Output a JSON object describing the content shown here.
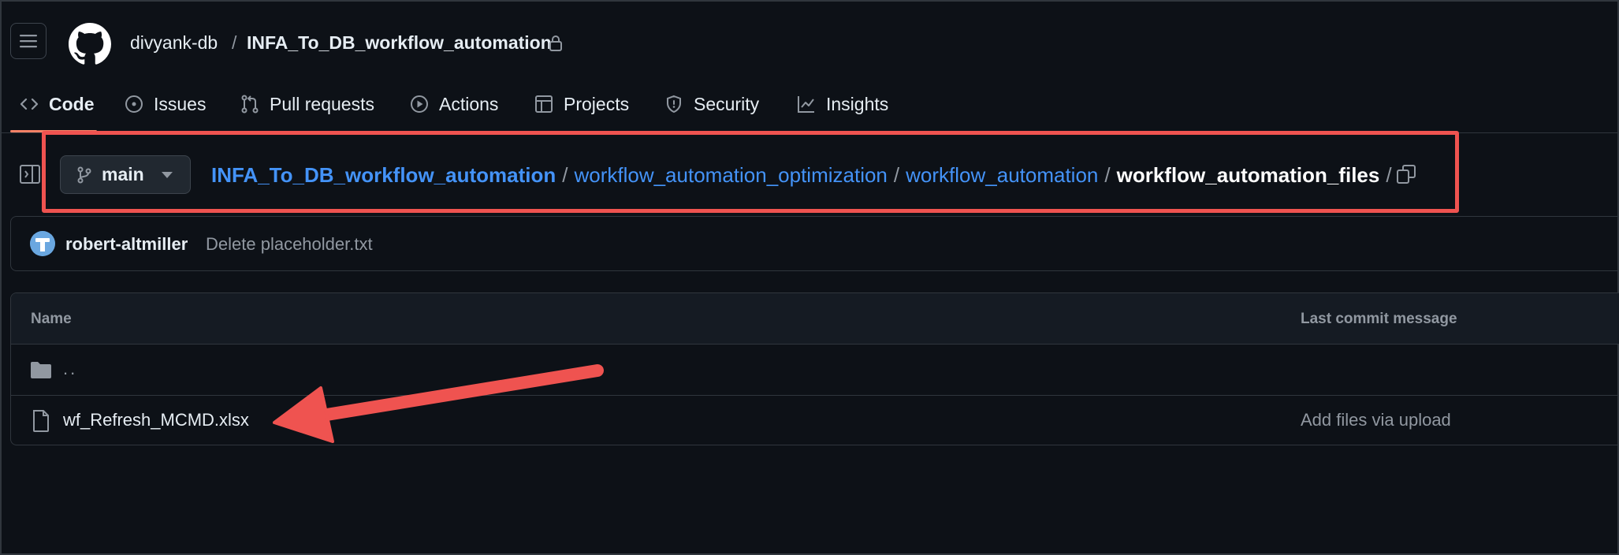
{
  "header": {
    "owner": "divyank-db",
    "separator": "/",
    "repo": "INFA_To_DB_workflow_automation"
  },
  "nav": {
    "tabs": [
      {
        "label": "Code",
        "icon": "code-icon",
        "active": true
      },
      {
        "label": "Issues",
        "icon": "issue-opened-icon"
      },
      {
        "label": "Pull requests",
        "icon": "git-pull-request-icon"
      },
      {
        "label": "Actions",
        "icon": "play-icon"
      },
      {
        "label": "Projects",
        "icon": "table-icon"
      },
      {
        "label": "Security",
        "icon": "shield-icon"
      },
      {
        "label": "Insights",
        "icon": "graph-icon"
      }
    ]
  },
  "branch": {
    "name": "main"
  },
  "path": {
    "segments": [
      "INFA_To_DB_workflow_automation",
      "workflow_automation_optimization",
      "workflow_automation"
    ],
    "separator": "/",
    "current": "workflow_automation_files",
    "trailing": "/"
  },
  "commit": {
    "author": "robert-altmiller",
    "message": "Delete placeholder.txt"
  },
  "table": {
    "headers": {
      "name": "Name",
      "last_commit": "Last commit message"
    },
    "rows": [
      {
        "type": "parent",
        "name": "..",
        "commit_message": ""
      },
      {
        "type": "file",
        "name": "wf_Refresh_MCMD.xlsx",
        "commit_message": "Add files via upload"
      }
    ]
  },
  "colors": {
    "background": "#0d1117",
    "link": "#4493f8",
    "annotation": "#ef5350",
    "active_tab_underline": "#f78166"
  }
}
